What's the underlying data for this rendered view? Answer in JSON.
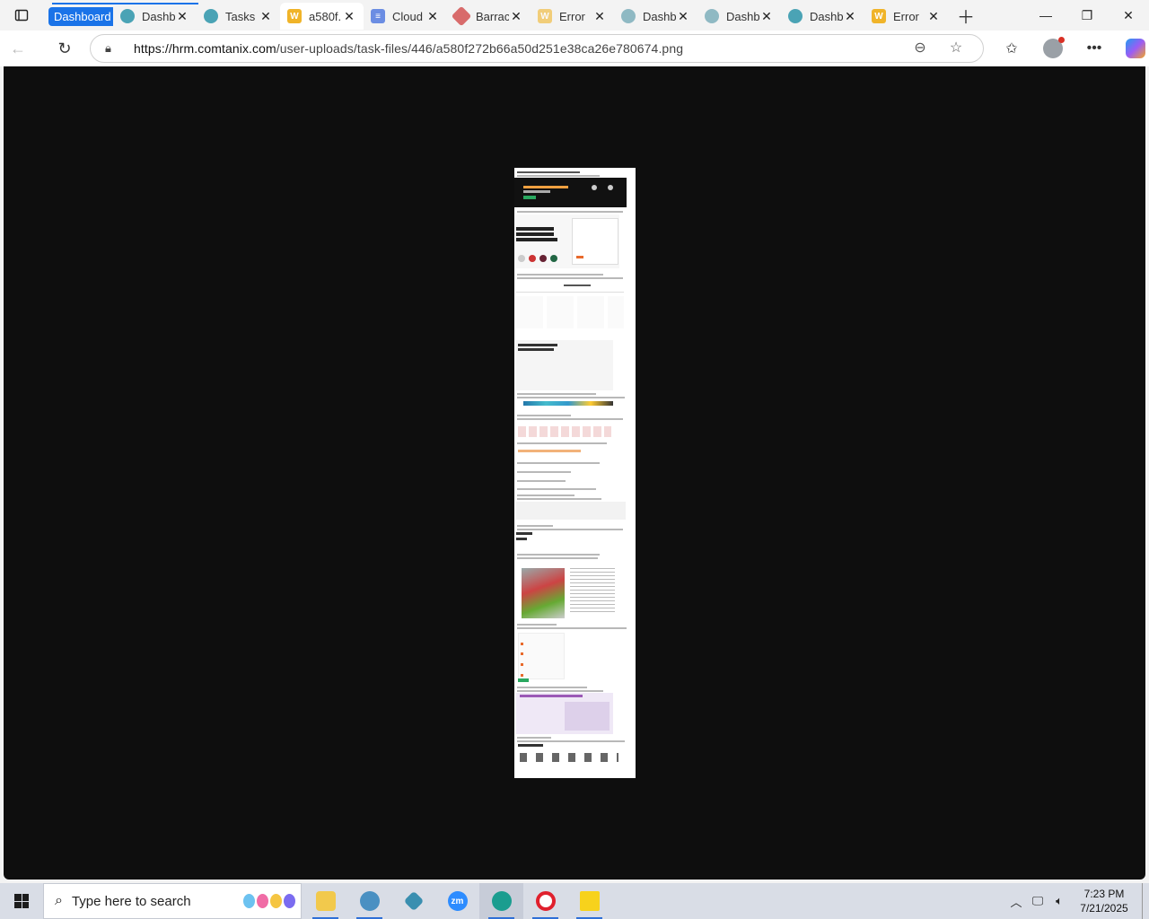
{
  "browser": {
    "tabs": [
      {
        "label": "Dashboard",
        "type": "group",
        "color": "#1a73e8"
      },
      {
        "label": "Dashb",
        "icon": "teal-circle-icon",
        "color": "#4aa3b5"
      },
      {
        "label": "Tasks",
        "icon": "teal-circle-icon",
        "color": "#4aa3b5"
      },
      {
        "label": "a580f.",
        "icon": "w-icon",
        "color": "#f0b429",
        "active": true
      },
      {
        "label": "Cloud",
        "icon": "doc-icon",
        "color": "#6b8de3"
      },
      {
        "label": "Barrac",
        "icon": "pencil-icon",
        "color": "#d86b6b"
      },
      {
        "label": "Error",
        "icon": "w-icon",
        "color": "#f0b429"
      },
      {
        "label": "Dashb",
        "icon": "teal-circle-icon",
        "color": "#8fb9c3"
      },
      {
        "label": "Dashb",
        "icon": "teal-circle-icon",
        "color": "#8fb9c3"
      },
      {
        "label": "Dashb",
        "icon": "teal-circle-icon",
        "color": "#4aa3b5"
      },
      {
        "label": "Error",
        "icon": "w-icon",
        "color": "#f0b429"
      }
    ],
    "url_host": "https://hrm.comtanix.com",
    "url_path": "/user-uploads/task-files/446/a580f272b66a50d251e38ca26e780674.png"
  },
  "taskbar": {
    "search_placeholder": "Type here to search",
    "time": "7:23 PM",
    "date": "7/21/2025",
    "apps": [
      {
        "name": "file-explorer-icon",
        "color": "#f2c94c"
      },
      {
        "name": "network-app-icon",
        "color": "#4a90c2"
      },
      {
        "name": "diamond-app-icon",
        "color": "#3a8fb0"
      },
      {
        "name": "zoom-icon",
        "color": "#2d8cff",
        "text": "zm"
      },
      {
        "name": "edge-icon",
        "color": "#1a9d8f"
      },
      {
        "name": "opera-icon",
        "color": "#e0202d"
      },
      {
        "name": "sticky-notes-icon",
        "color": "#f7d21c"
      }
    ]
  }
}
